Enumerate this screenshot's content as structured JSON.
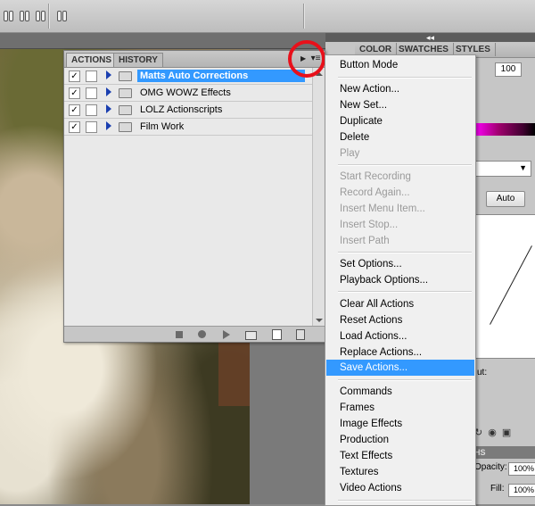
{
  "actions_panel": {
    "tabs": [
      "ACTIONS",
      "HISTORY"
    ],
    "menu_icon": "panel-menu-icon",
    "sets": [
      {
        "name": "Matts Auto Corrections",
        "checked": true,
        "selected": true
      },
      {
        "name": "OMG WOWZ Effects",
        "checked": true,
        "selected": false
      },
      {
        "name": "LOLZ Actionscripts",
        "checked": true,
        "selected": false
      },
      {
        "name": "Film Work",
        "checked": true,
        "selected": false
      }
    ],
    "checkmark": "✓",
    "footer_icons": [
      "stop-icon",
      "record-icon",
      "play-icon",
      "new-set-icon",
      "new-action-icon",
      "delete-icon"
    ]
  },
  "right_panel": {
    "collapse_glyph": "◂◂",
    "color_tabs": [
      "COLOR",
      "SWATCHES",
      "STYLES"
    ],
    "color_value": "100",
    "auto_button": "Auto",
    "output_label": "ut:",
    "layers_tab": "HS",
    "opacity_label": "Opacity:",
    "opacity_value": "100%",
    "fill_label": "Fill:",
    "fill_value": "100%"
  },
  "flyout_menu": {
    "groups": [
      [
        {
          "label": "Button Mode",
          "enabled": true
        }
      ],
      [
        {
          "label": "New Action...",
          "enabled": true
        },
        {
          "label": "New Set...",
          "enabled": true
        },
        {
          "label": "Duplicate",
          "enabled": true
        },
        {
          "label": "Delete",
          "enabled": true
        },
        {
          "label": "Play",
          "enabled": false
        }
      ],
      [
        {
          "label": "Start Recording",
          "enabled": false
        },
        {
          "label": "Record Again...",
          "enabled": false
        },
        {
          "label": "Insert Menu Item...",
          "enabled": false
        },
        {
          "label": "Insert Stop...",
          "enabled": false
        },
        {
          "label": "Insert Path",
          "enabled": false
        }
      ],
      [
        {
          "label": "Set Options...",
          "enabled": true
        },
        {
          "label": "Playback Options...",
          "enabled": true
        }
      ],
      [
        {
          "label": "Clear All Actions",
          "enabled": true
        },
        {
          "label": "Reset Actions",
          "enabled": true
        },
        {
          "label": "Load Actions...",
          "enabled": true
        },
        {
          "label": "Replace Actions...",
          "enabled": true
        },
        {
          "label": "Save Actions...",
          "enabled": true,
          "highlighted": true
        }
      ],
      [
        {
          "label": "Commands",
          "enabled": true
        },
        {
          "label": "Frames",
          "enabled": true
        },
        {
          "label": "Image Effects",
          "enabled": true
        },
        {
          "label": "Production",
          "enabled": true
        },
        {
          "label": "Text Effects",
          "enabled": true
        },
        {
          "label": "Textures",
          "enabled": true
        },
        {
          "label": "Video Actions",
          "enabled": true
        }
      ]
    ]
  },
  "colors": {
    "selection": "#3399ff",
    "highlight_circle": "#e8101a"
  }
}
